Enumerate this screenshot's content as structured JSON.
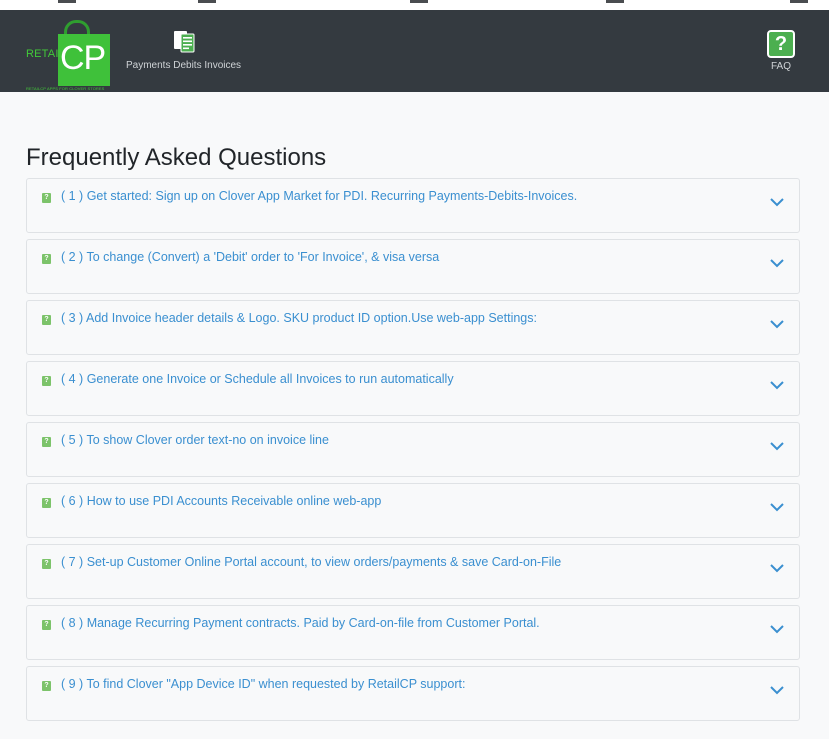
{
  "logo": {
    "retail_text": "RETAIL",
    "cp_text": "CP",
    "tagline": "RETAILCP APPS FOR CLOVER STORES"
  },
  "nav": {
    "pdi_label": "Payments Debits Invoices",
    "pdi_icon": "invoice-stack-icon",
    "faq_label": "FAQ",
    "faq_icon": "help-question-icon",
    "faq_glyph": "?"
  },
  "page": {
    "title": "Frequently Asked Questions"
  },
  "faq": {
    "question_glyph": "?",
    "items": [
      {
        "text": "( 1 ) Get started: Sign up on Clover App Market for PDI. Recurring Payments-Debits-Invoices."
      },
      {
        "text": "( 2 ) To change (Convert) a 'Debit' order to 'For Invoice', & visa versa"
      },
      {
        "text": "( 3 ) Add Invoice header details & Logo. SKU product ID option.Use web-app Settings:"
      },
      {
        "text": "( 4 ) Generate one Invoice or Schedule all Invoices to run automatically"
      },
      {
        "text": "( 5 ) To show Clover order text-no on invoice line"
      },
      {
        "text": "( 6 ) How to use PDI Accounts Receivable online web-app"
      },
      {
        "text": "( 7 ) Set-up Customer Online Portal account, to view orders/payments & save Card-on-File"
      },
      {
        "text": "( 8 ) Manage Recurring Payment contracts. Paid by Card-on-file from Customer Portal."
      },
      {
        "text": "( 9 ) To find Clover \"App Device ID\" when requested by RetailCP support:"
      }
    ]
  },
  "colors": {
    "navbar": "#343a40",
    "brand_green": "#3fc13a",
    "link_blue": "#3a8fd0",
    "chevron_blue": "#3a8fd0"
  }
}
